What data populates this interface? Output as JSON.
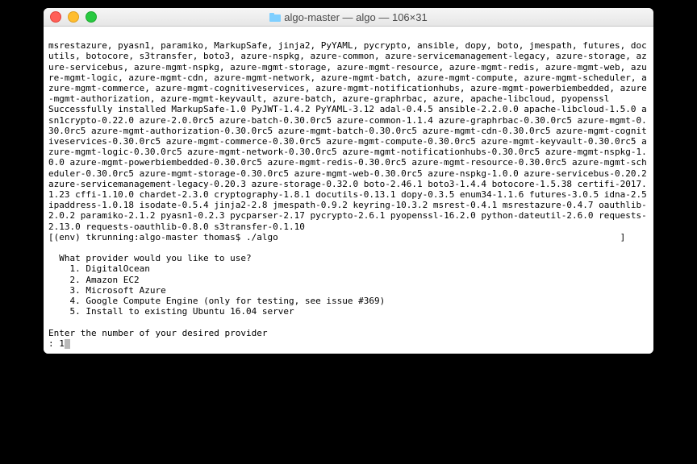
{
  "window": {
    "title": "algo-master — algo — 106×31"
  },
  "terminal": {
    "packages_line": "msrestazure, pyasn1, paramiko, MarkupSafe, jinja2, PyYAML, pycrypto, ansible, dopy, boto, jmespath, futures, docutils, botocore, s3transfer, boto3, azure-nspkg, azure-common, azure-servicemanagement-legacy, azure-storage, azure-servicebus, azure-mgmt-nspkg, azure-mgmt-storage, azure-mgmt-resource, azure-mgmt-redis, azure-mgmt-web, azure-mgmt-logic, azure-mgmt-cdn, azure-mgmt-network, azure-mgmt-batch, azure-mgmt-compute, azure-mgmt-scheduler, azure-mgmt-commerce, azure-mgmt-cognitiveservices, azure-mgmt-notificationhubs, azure-mgmt-powerbiembedded, azure-mgmt-authorization, azure-mgmt-keyvault, azure-batch, azure-graphrbac, azure, apache-libcloud, pyopenssl",
    "success_line": "Successfully installed MarkupSafe-1.0 PyJWT-1.4.2 PyYAML-3.12 adal-0.4.5 ansible-2.2.0.0 apache-libcloud-1.5.0 asn1crypto-0.22.0 azure-2.0.0rc5 azure-batch-0.30.0rc5 azure-common-1.1.4 azure-graphrbac-0.30.0rc5 azure-mgmt-0.30.0rc5 azure-mgmt-authorization-0.30.0rc5 azure-mgmt-batch-0.30.0rc5 azure-mgmt-cdn-0.30.0rc5 azure-mgmt-cognitiveservices-0.30.0rc5 azure-mgmt-commerce-0.30.0rc5 azure-mgmt-compute-0.30.0rc5 azure-mgmt-keyvault-0.30.0rc5 azure-mgmt-logic-0.30.0rc5 azure-mgmt-network-0.30.0rc5 azure-mgmt-notificationhubs-0.30.0rc5 azure-mgmt-nspkg-1.0.0 azure-mgmt-powerbiembedded-0.30.0rc5 azure-mgmt-redis-0.30.0rc5 azure-mgmt-resource-0.30.0rc5 azure-mgmt-scheduler-0.30.0rc5 azure-mgmt-storage-0.30.0rc5 azure-mgmt-web-0.30.0rc5 azure-nspkg-1.0.0 azure-servicebus-0.20.2 azure-servicemanagement-legacy-0.20.3 azure-storage-0.32.0 boto-2.46.1 boto3-1.4.4 botocore-1.5.38 certifi-2017.1.23 cffi-1.10.0 chardet-2.3.0 cryptography-1.8.1 docutils-0.13.1 dopy-0.3.5 enum34-1.1.6 futures-3.0.5 idna-2.5 ipaddress-1.0.18 isodate-0.5.4 jinja2-2.8 jmespath-0.9.2 keyring-10.3.2 msrest-0.4.1 msrestazure-0.4.7 oauthlib-2.0.2 paramiko-2.1.2 pyasn1-0.2.3 pycparser-2.17 pycrypto-2.6.1 pyopenssl-16.2.0 python-dateutil-2.6.0 requests-2.13.0 requests-oauthlib-0.8.0 s3transfer-0.1.10",
    "prompt_prefix": "[",
    "prompt_env": "(env) tkrunning:algo-master thomas$",
    "prompt_cmd": " ./algo",
    "prompt_suffix": "]",
    "blank": "",
    "question": "  What provider would you like to use?",
    "options": [
      "    1. DigitalOcean",
      "    2. Amazon EC2",
      "    3. Microsoft Azure",
      "    4. Google Compute Engine (only for testing, see issue #369)",
      "    5. Install to existing Ubuntu 16.04 server"
    ],
    "enter_prompt": "Enter the number of your desired provider",
    "input_prefix": ": ",
    "input_value": "1"
  }
}
